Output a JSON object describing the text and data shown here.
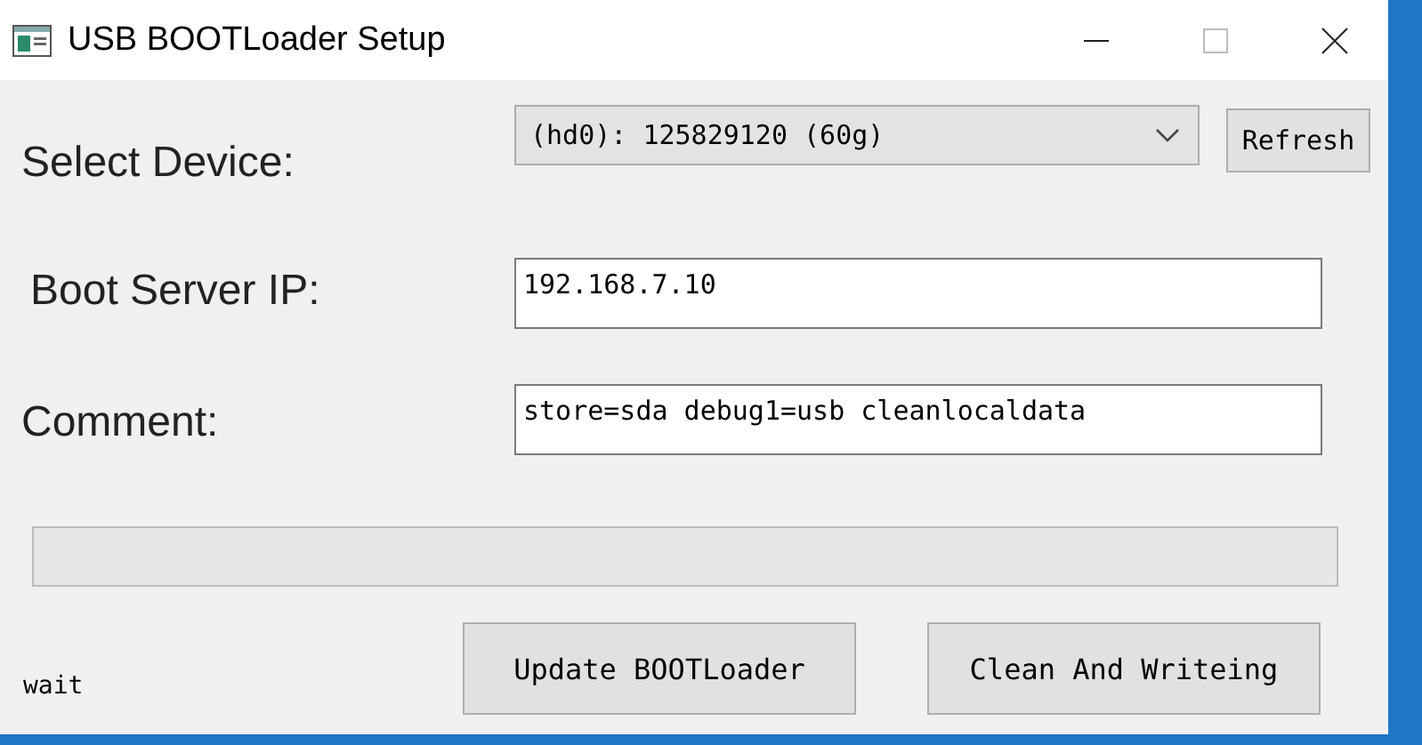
{
  "window": {
    "title": "USB BOOTLoader Setup"
  },
  "device": {
    "label": "Select Device:",
    "value": "(hd0): 125829120 (60g)",
    "refresh": "Refresh"
  },
  "server_ip": {
    "label": "Boot Server IP:",
    "value": "192.168.7.10"
  },
  "comment": {
    "label": "Comment:",
    "value": "store=sda debug1=usb cleanlocaldata"
  },
  "status": "wait",
  "buttons": [
    "Update BOOTLoader",
    "Clean And Writeing"
  ]
}
